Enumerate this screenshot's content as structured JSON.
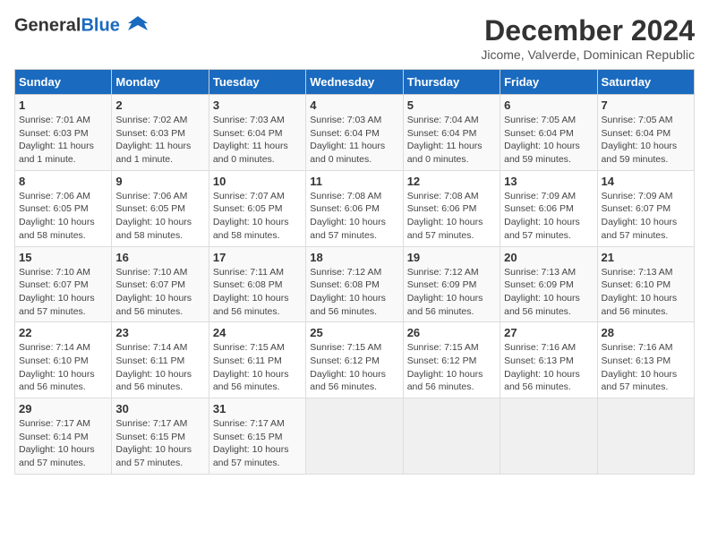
{
  "header": {
    "logo_line1": "General",
    "logo_line2": "Blue",
    "month_title": "December 2024",
    "subtitle": "Jicome, Valverde, Dominican Republic"
  },
  "weekdays": [
    "Sunday",
    "Monday",
    "Tuesday",
    "Wednesday",
    "Thursday",
    "Friday",
    "Saturday"
  ],
  "weeks": [
    [
      {
        "day": "1",
        "sunrise": "Sunrise: 7:01 AM",
        "sunset": "Sunset: 6:03 PM",
        "daylight": "Daylight: 11 hours and 1 minute."
      },
      {
        "day": "2",
        "sunrise": "Sunrise: 7:02 AM",
        "sunset": "Sunset: 6:03 PM",
        "daylight": "Daylight: 11 hours and 1 minute."
      },
      {
        "day": "3",
        "sunrise": "Sunrise: 7:03 AM",
        "sunset": "Sunset: 6:04 PM",
        "daylight": "Daylight: 11 hours and 0 minutes."
      },
      {
        "day": "4",
        "sunrise": "Sunrise: 7:03 AM",
        "sunset": "Sunset: 6:04 PM",
        "daylight": "Daylight: 11 hours and 0 minutes."
      },
      {
        "day": "5",
        "sunrise": "Sunrise: 7:04 AM",
        "sunset": "Sunset: 6:04 PM",
        "daylight": "Daylight: 11 hours and 0 minutes."
      },
      {
        "day": "6",
        "sunrise": "Sunrise: 7:05 AM",
        "sunset": "Sunset: 6:04 PM",
        "daylight": "Daylight: 10 hours and 59 minutes."
      },
      {
        "day": "7",
        "sunrise": "Sunrise: 7:05 AM",
        "sunset": "Sunset: 6:04 PM",
        "daylight": "Daylight: 10 hours and 59 minutes."
      }
    ],
    [
      {
        "day": "8",
        "sunrise": "Sunrise: 7:06 AM",
        "sunset": "Sunset: 6:05 PM",
        "daylight": "Daylight: 10 hours and 58 minutes."
      },
      {
        "day": "9",
        "sunrise": "Sunrise: 7:06 AM",
        "sunset": "Sunset: 6:05 PM",
        "daylight": "Daylight: 10 hours and 58 minutes."
      },
      {
        "day": "10",
        "sunrise": "Sunrise: 7:07 AM",
        "sunset": "Sunset: 6:05 PM",
        "daylight": "Daylight: 10 hours and 58 minutes."
      },
      {
        "day": "11",
        "sunrise": "Sunrise: 7:08 AM",
        "sunset": "Sunset: 6:06 PM",
        "daylight": "Daylight: 10 hours and 57 minutes."
      },
      {
        "day": "12",
        "sunrise": "Sunrise: 7:08 AM",
        "sunset": "Sunset: 6:06 PM",
        "daylight": "Daylight: 10 hours and 57 minutes."
      },
      {
        "day": "13",
        "sunrise": "Sunrise: 7:09 AM",
        "sunset": "Sunset: 6:06 PM",
        "daylight": "Daylight: 10 hours and 57 minutes."
      },
      {
        "day": "14",
        "sunrise": "Sunrise: 7:09 AM",
        "sunset": "Sunset: 6:07 PM",
        "daylight": "Daylight: 10 hours and 57 minutes."
      }
    ],
    [
      {
        "day": "15",
        "sunrise": "Sunrise: 7:10 AM",
        "sunset": "Sunset: 6:07 PM",
        "daylight": "Daylight: 10 hours and 57 minutes."
      },
      {
        "day": "16",
        "sunrise": "Sunrise: 7:10 AM",
        "sunset": "Sunset: 6:07 PM",
        "daylight": "Daylight: 10 hours and 56 minutes."
      },
      {
        "day": "17",
        "sunrise": "Sunrise: 7:11 AM",
        "sunset": "Sunset: 6:08 PM",
        "daylight": "Daylight: 10 hours and 56 minutes."
      },
      {
        "day": "18",
        "sunrise": "Sunrise: 7:12 AM",
        "sunset": "Sunset: 6:08 PM",
        "daylight": "Daylight: 10 hours and 56 minutes."
      },
      {
        "day": "19",
        "sunrise": "Sunrise: 7:12 AM",
        "sunset": "Sunset: 6:09 PM",
        "daylight": "Daylight: 10 hours and 56 minutes."
      },
      {
        "day": "20",
        "sunrise": "Sunrise: 7:13 AM",
        "sunset": "Sunset: 6:09 PM",
        "daylight": "Daylight: 10 hours and 56 minutes."
      },
      {
        "day": "21",
        "sunrise": "Sunrise: 7:13 AM",
        "sunset": "Sunset: 6:10 PM",
        "daylight": "Daylight: 10 hours and 56 minutes."
      }
    ],
    [
      {
        "day": "22",
        "sunrise": "Sunrise: 7:14 AM",
        "sunset": "Sunset: 6:10 PM",
        "daylight": "Daylight: 10 hours and 56 minutes."
      },
      {
        "day": "23",
        "sunrise": "Sunrise: 7:14 AM",
        "sunset": "Sunset: 6:11 PM",
        "daylight": "Daylight: 10 hours and 56 minutes."
      },
      {
        "day": "24",
        "sunrise": "Sunrise: 7:15 AM",
        "sunset": "Sunset: 6:11 PM",
        "daylight": "Daylight: 10 hours and 56 minutes."
      },
      {
        "day": "25",
        "sunrise": "Sunrise: 7:15 AM",
        "sunset": "Sunset: 6:12 PM",
        "daylight": "Daylight: 10 hours and 56 minutes."
      },
      {
        "day": "26",
        "sunrise": "Sunrise: 7:15 AM",
        "sunset": "Sunset: 6:12 PM",
        "daylight": "Daylight: 10 hours and 56 minutes."
      },
      {
        "day": "27",
        "sunrise": "Sunrise: 7:16 AM",
        "sunset": "Sunset: 6:13 PM",
        "daylight": "Daylight: 10 hours and 56 minutes."
      },
      {
        "day": "28",
        "sunrise": "Sunrise: 7:16 AM",
        "sunset": "Sunset: 6:13 PM",
        "daylight": "Daylight: 10 hours and 57 minutes."
      }
    ],
    [
      {
        "day": "29",
        "sunrise": "Sunrise: 7:17 AM",
        "sunset": "Sunset: 6:14 PM",
        "daylight": "Daylight: 10 hours and 57 minutes."
      },
      {
        "day": "30",
        "sunrise": "Sunrise: 7:17 AM",
        "sunset": "Sunset: 6:15 PM",
        "daylight": "Daylight: 10 hours and 57 minutes."
      },
      {
        "day": "31",
        "sunrise": "Sunrise: 7:17 AM",
        "sunset": "Sunset: 6:15 PM",
        "daylight": "Daylight: 10 hours and 57 minutes."
      },
      null,
      null,
      null,
      null
    ]
  ]
}
